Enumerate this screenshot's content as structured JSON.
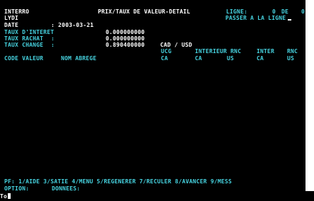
{
  "header": {
    "title": "INTERRO",
    "screen_title": "PRIX/TAUX DE VALEUR-DETAIL",
    "line_label": "LIGNE:",
    "line_value": "0",
    "of_label": "DE",
    "of_value": "0",
    "user": "LYDI",
    "goto_line_label": "PASSER A LA LIGNE"
  },
  "fields": {
    "date_label": "DATE",
    "date_value": ": 2003-03-21",
    "interest_label": "TAUX D'INTERET",
    "interest_value": "0.000000000",
    "buyback_label": "TAUX RACHAT",
    "buyback_sep": ":",
    "buyback_value": "0.000000000",
    "exchange_label": "TAUX CHANGE",
    "exchange_sep": ":",
    "exchange_value": "0.890400000",
    "exchange_pair": "CAD / USD"
  },
  "table": {
    "col_code": "CODE VALEUR",
    "col_name": "NOM ABREGE",
    "col_ucg": "UCG",
    "col_ucg_sub": "CA",
    "col_interior": "INTERIEUR RNC",
    "col_interior_sub_a": "CA",
    "col_interior_sub_b": "US",
    "col_inter": "INTER",
    "col_inter_sub": "CA",
    "col_rnc": "RNC",
    "col_rnc_sub": "US"
  },
  "footer": {
    "pf_keys": "PF: 1/AIDE 3/SATIE 4/MENU 5/REGENERER 7/RECULER 8/AVANCER 9/MESS",
    "option_label": "OPTION:",
    "data_label": "DONNEES:",
    "prompt": "To"
  },
  "colors": {
    "background": "#000000",
    "text_white": "#ffffff",
    "text_cyan": "#46d2df"
  }
}
